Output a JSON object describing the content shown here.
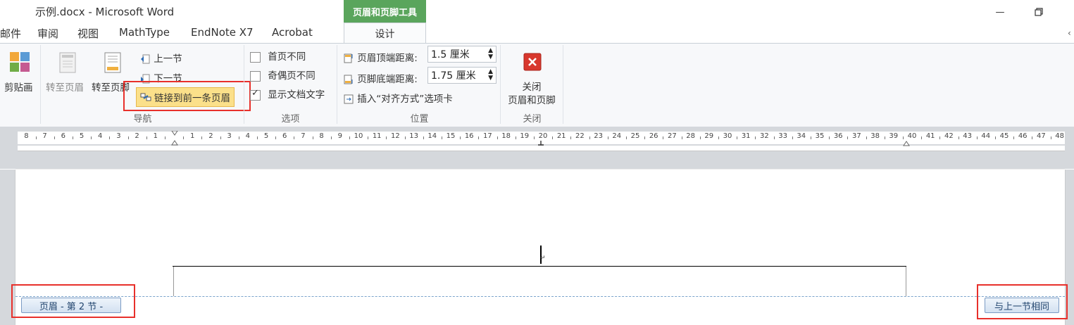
{
  "window": {
    "title": "示例.docx - Microsoft Word"
  },
  "contextual_tab": {
    "group_label": "页眉和页脚工具",
    "tab_label": "设计"
  },
  "tabs": [
    "邮件",
    "审阅",
    "视图",
    "MathType",
    "EndNote X7",
    "Acrobat"
  ],
  "ribbon": {
    "insert": {
      "clipart_label": "剪贴画"
    },
    "nav": {
      "goto_header": "转至页眉",
      "goto_footer": "转至页脚",
      "prev_section": "上一节",
      "next_section": "下一节",
      "link_previous": "链接到前一条页眉",
      "group": "导航"
    },
    "options": {
      "first_page": "首页不同",
      "odd_even": "奇偶页不同",
      "show_text": "显示文档文字",
      "group": "选项",
      "first_page_checked": false,
      "odd_even_checked": false,
      "show_text_checked": true
    },
    "position": {
      "header_top_label": "页眉顶端距离:",
      "header_top_value": "1.5 厘米",
      "footer_bottom_label": "页脚底端距离:",
      "footer_bottom_value": "1.75 厘米",
      "insert_align_tab": "插入“对齐方式”选项卡",
      "group": "位置"
    },
    "close": {
      "label_line1": "关闭",
      "label_line2": "页眉和页脚",
      "group": "关闭"
    }
  },
  "ruler": {
    "left_labels": [
      "8",
      "7",
      "6",
      "5",
      "4",
      "3",
      "2",
      "1"
    ],
    "right_labels": [
      "1",
      "2",
      "3",
      "4",
      "5",
      "6",
      "7",
      "8",
      "9",
      "10",
      "11",
      "12",
      "13",
      "14",
      "15",
      "16",
      "17",
      "18",
      "19",
      "20",
      "21",
      "22",
      "23",
      "24",
      "25",
      "26",
      "27",
      "28",
      "29",
      "30",
      "31",
      "32",
      "33",
      "34",
      "35",
      "36",
      "37",
      "38",
      "39",
      "40",
      "41",
      "42",
      "43",
      "44",
      "45",
      "46",
      "47",
      "48"
    ]
  },
  "document": {
    "header_tag": "页眉 - 第 2 节 -",
    "same_as_previous": "与上一节相同"
  }
}
